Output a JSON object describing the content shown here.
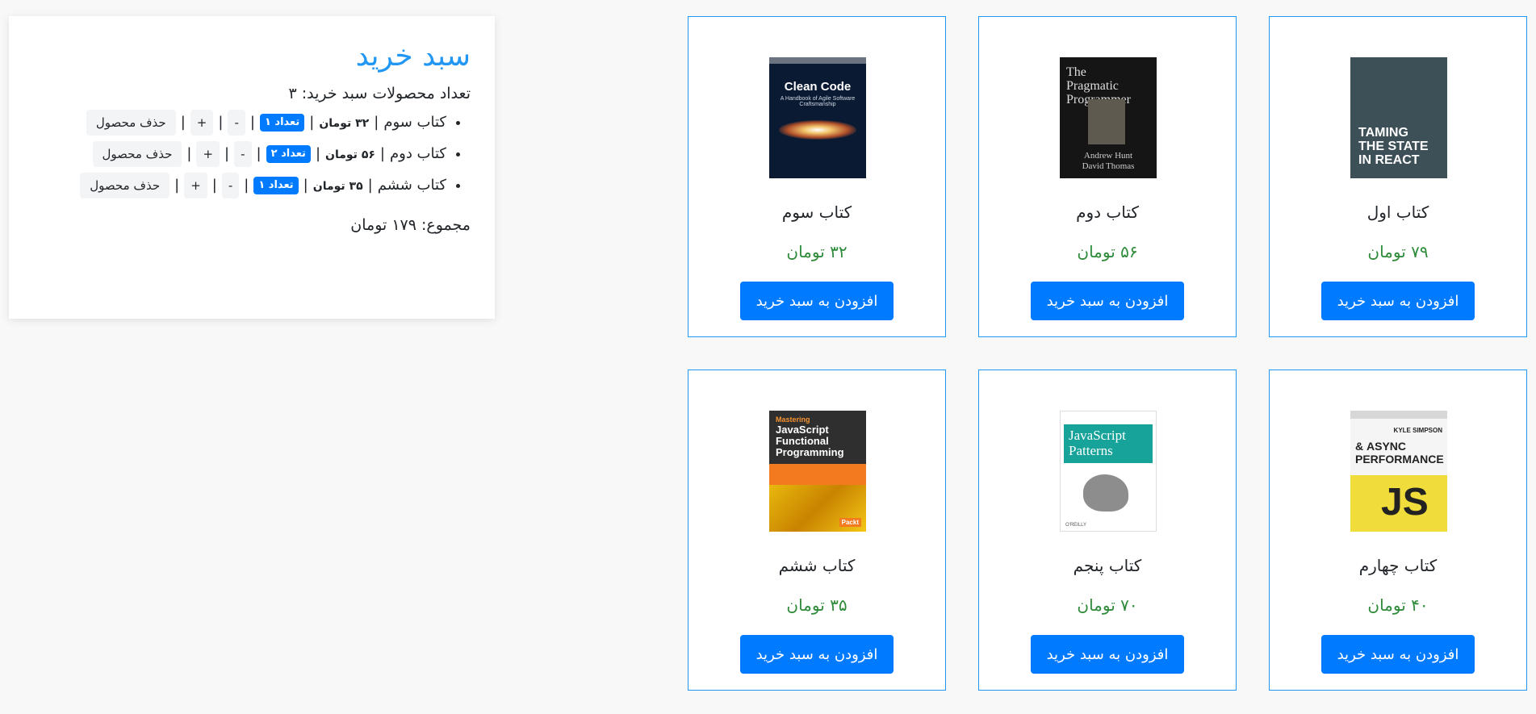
{
  "cart": {
    "title": "سبد خرید",
    "count_text": "تعداد محصولات سبد خرید: ۳",
    "items": [
      {
        "name": "کتاب سوم",
        "price": "۳۲ تومان",
        "qty": "تعداد ۱",
        "plus": "+",
        "minus": "-",
        "remove": "حذف محصول"
      },
      {
        "name": "کتاب دوم",
        "price": "۵۶ تومان",
        "qty": "تعداد ۲",
        "plus": "+",
        "minus": "-",
        "remove": "حذف محصول"
      },
      {
        "name": "کتاب ششم",
        "price": "۳۵ تومان",
        "qty": "تعداد ۱",
        "plus": "+",
        "minus": "-",
        "remove": "حذف محصول"
      }
    ],
    "separator": "|",
    "total_text": "مجموع: ۱۷۹ تومان"
  },
  "products": [
    {
      "title": "کتاب اول",
      "price": "۷۹ تومان",
      "button": "افزودن به سبد خرید",
      "cover": {
        "lines": [
          "TAMING",
          "THE STATE",
          "IN REACT"
        ]
      }
    },
    {
      "title": "کتاب دوم",
      "price": "۵۶ تومان",
      "button": "افزودن به سبد خرید",
      "cover": {
        "lines": [
          "The",
          "Pragmatic",
          "Programmer"
        ],
        "authors": [
          "Andrew Hunt",
          "David Thomas"
        ]
      }
    },
    {
      "title": "کتاب سوم",
      "price": "۳۲ تومان",
      "button": "افزودن به سبد خرید",
      "cover": {
        "title": "Clean Code",
        "subtitle": "A Handbook of Agile Software Craftsmanship"
      }
    },
    {
      "title": "کتاب چهارم",
      "price": "۴۰ تومان",
      "button": "افزودن به سبد خرید",
      "cover": {
        "author": "KYLE SIMPSON",
        "lines": [
          "ASYNC &",
          "PERFORMANCE"
        ],
        "mark": "JS"
      }
    },
    {
      "title": "کتاب پنجم",
      "price": "۷۰ تومان",
      "button": "افزودن به سبد خرید",
      "cover": {
        "lines": [
          "JavaScript",
          "Patterns"
        ],
        "footer": "O'REILLY"
      }
    },
    {
      "title": "کتاب ششم",
      "price": "۳۵ تومان",
      "button": "افزودن به سبد خرید",
      "cover": {
        "tag": "Mastering",
        "lines": [
          "JavaScript",
          "Functional",
          "Programming"
        ],
        "publisher": "Packt"
      }
    }
  ],
  "colors": {
    "accent": "#007bff",
    "title_blue": "#2196f3",
    "price_green": "#2e8b3a",
    "border": "#2196f3"
  }
}
